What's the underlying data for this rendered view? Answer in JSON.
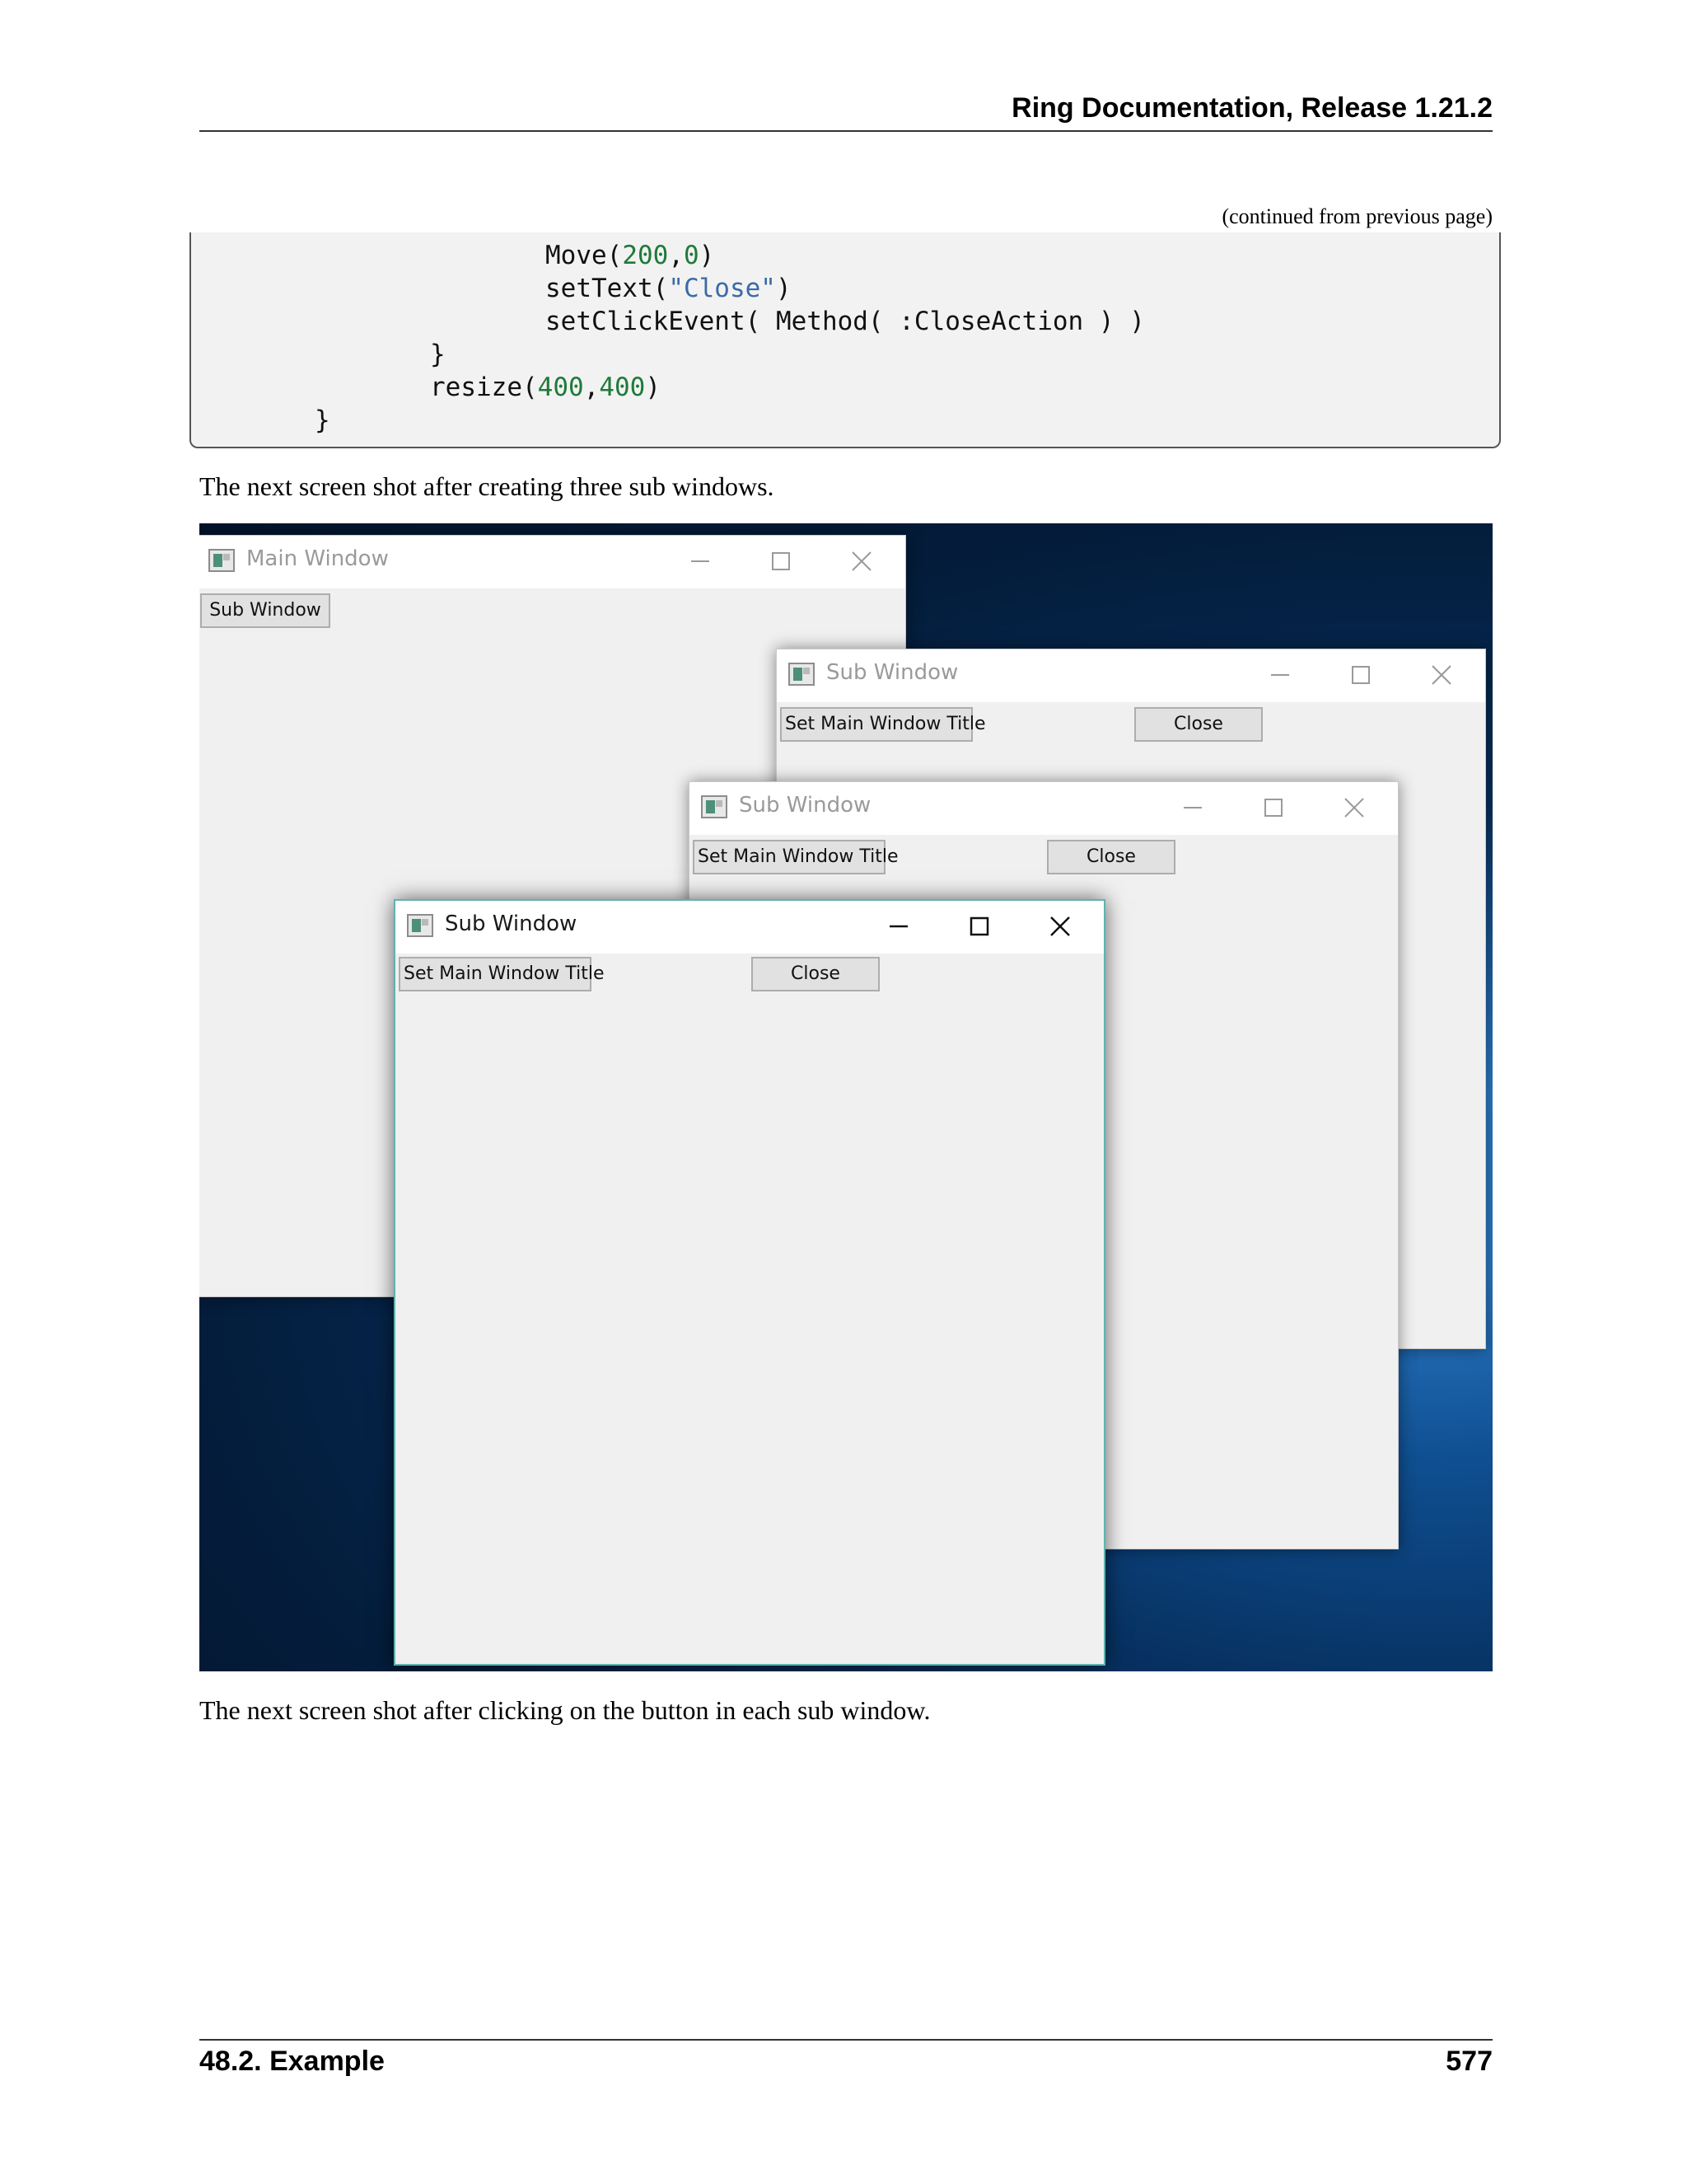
{
  "header": {
    "title": "Ring Documentation, Release 1.21.2"
  },
  "continued_note": "(continued from previous page)",
  "code": {
    "line1": {
      "a": "Move(",
      "n1": "200",
      "comma": ",",
      "n2": "0",
      "b": ")"
    },
    "line2": {
      "a": "setText(",
      "s": "\"Close\"",
      "b": ")"
    },
    "line3": "setClickEvent( Method( :CloseAction ) )",
    "line4": "}",
    "line5": {
      "a": "resize(",
      "n1": "400",
      "comma": ",",
      "n2": "400",
      "b": ")"
    },
    "line6": "}"
  },
  "text": {
    "para1": "The next screen shot after creating three sub windows.",
    "para2": "The next screen shot after clicking on the button in each sub window."
  },
  "screenshot": {
    "main_window": {
      "title": "Main Window",
      "button": "Sub Window"
    },
    "sub_windows": [
      {
        "title": "Sub Window",
        "set_title_button": "Set Main Window Title",
        "close_button": "Close"
      },
      {
        "title": "Sub Window",
        "set_title_button": "Set Main Window Title",
        "close_button": "Close"
      },
      {
        "title": "Sub Window",
        "set_title_button": "Set Main Window Title",
        "close_button": "Close"
      }
    ]
  },
  "footer": {
    "section": "48.2.  Example",
    "page": "577"
  }
}
